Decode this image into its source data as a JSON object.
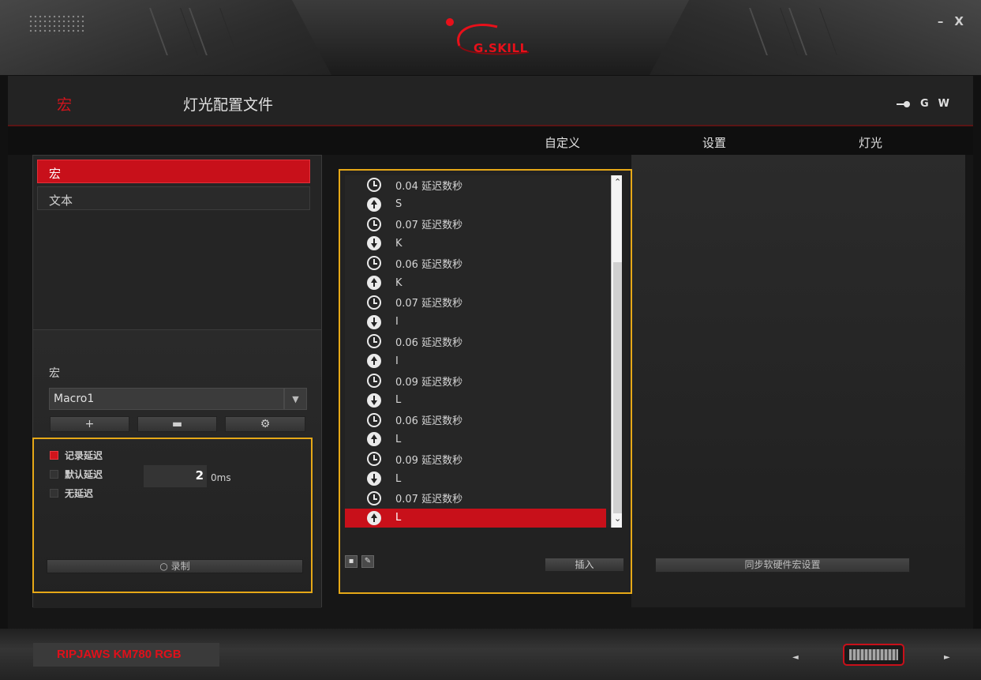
{
  "window": {
    "brand": "G.SKILL",
    "minimize": "–",
    "close": "X"
  },
  "header": {
    "nav_macro": "宏",
    "nav_profile": "灯光配置文件",
    "icons": {
      "usb": "usb-icon",
      "g": "G",
      "w": "W"
    }
  },
  "subtabs": [
    "自定义",
    "设置",
    "灯光"
  ],
  "left": {
    "types": [
      {
        "label": "宏",
        "active": true
      },
      {
        "label": "文本",
        "active": false
      }
    ],
    "macro_label": "宏",
    "macro_selected": "Macro1",
    "buttons": {
      "add": "+",
      "delete": "▬",
      "settings": "⚙"
    },
    "options": [
      {
        "label": "记录延迟",
        "checked": true
      },
      {
        "label": "默认延迟",
        "checked": false
      },
      {
        "label": "无延迟",
        "checked": false
      }
    ],
    "delay_value": "2",
    "delay_unit": "0ms",
    "record_button": "录制"
  },
  "list": {
    "rows": [
      {
        "icon": "clock",
        "text": "0.04 延迟数秒"
      },
      {
        "icon": "up",
        "text": "S"
      },
      {
        "icon": "clock",
        "text": "0.07 延迟数秒"
      },
      {
        "icon": "down",
        "text": "K"
      },
      {
        "icon": "clock",
        "text": "0.06 延迟数秒"
      },
      {
        "icon": "up",
        "text": "K"
      },
      {
        "icon": "clock",
        "text": "0.07 延迟数秒"
      },
      {
        "icon": "down",
        "text": "I"
      },
      {
        "icon": "clock",
        "text": "0.06 延迟数秒"
      },
      {
        "icon": "up",
        "text": "I"
      },
      {
        "icon": "clock",
        "text": "0.09 延迟数秒"
      },
      {
        "icon": "down",
        "text": "L"
      },
      {
        "icon": "clock",
        "text": "0.06 延迟数秒"
      },
      {
        "icon": "up",
        "text": "L"
      },
      {
        "icon": "clock",
        "text": "0.09 延迟数秒"
      },
      {
        "icon": "down",
        "text": "L"
      },
      {
        "icon": "clock",
        "text": "0.07 延迟数秒"
      },
      {
        "icon": "up",
        "text": "L",
        "selected": true
      }
    ],
    "insert_button": "插入"
  },
  "right": {
    "sync_button": "同步软硬件宏设置"
  },
  "footer": {
    "device_name": "RIPJAWS KM780 RGB",
    "prev": "◄",
    "next": "►"
  },
  "colors": {
    "accent": "#c8101a",
    "highlight_border": "#e6a817"
  }
}
